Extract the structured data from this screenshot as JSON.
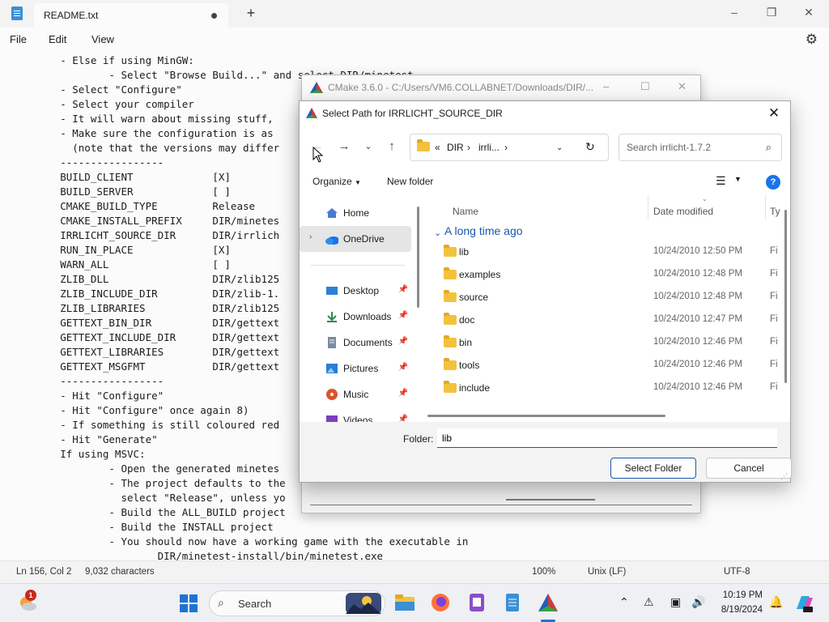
{
  "notepad": {
    "tab_title": "README.txt",
    "new_tab": "+",
    "menu": [
      "File",
      "Edit",
      "View"
    ],
    "lines_left": [
      "        - Else if using MinGW:",
      "                - Select \"Browse Build...\" and select DIR/minetest",
      "        - Select \"Configure\"",
      "        - Select your compiler",
      "        - It will warn about missing stuff,",
      "        - Make sure the configuration is as",
      "          (note that the versions may differ",
      "        -----------------",
      "        BUILD_CLIENT             [X]",
      "        BUILD_SERVER             [ ]",
      "        CMAKE_BUILD_TYPE         Release",
      "        CMAKE_INSTALL_PREFIX     DIR/minetes",
      "        IRRLICHT_SOURCE_DIR      DIR/irrlich",
      "        RUN_IN_PLACE             [X]",
      "        WARN_ALL                 [ ]",
      "        ZLIB_DLL                 DIR/zlib125",
      "        ZLIB_INCLUDE_DIR         DIR/zlib-1.",
      "        ZLIB_LIBRARIES           DIR/zlib125",
      "        GETTEXT_BIN_DIR          DIR/gettext",
      "        GETTEXT_INCLUDE_DIR      DIR/gettext",
      "        GETTEXT_LIBRARIES        DIR/gettext",
      "        GETTEXT_MSGFMT           DIR/gettext",
      "        -----------------",
      "        - Hit \"Configure\"",
      "        - Hit \"Configure\" once again 8)",
      "        - If something is still coloured red",
      "        - Hit \"Generate\"",
      "        If using MSVC:",
      "                - Open the generated minetes",
      "                - The project defaults to the",
      "                  select \"Release\", unless yo",
      "                - Build the ALL_BUILD project",
      "                - Build the INSTALL project",
      "                - You should now have a working game with the executable in",
      "                        DIR/minetest-install/bin/minetest.exe"
    ],
    "status": {
      "position": "Ln 156, Col 2",
      "chars": "9,032 characters",
      "zoom": "100%",
      "line_ending": "Unix (LF)",
      "encoding": "UTF-8"
    }
  },
  "cmake": {
    "title": "CMake 3.6.0 - C:/Users/VM6.COLLABNET/Downloads/DIR/..."
  },
  "dialog": {
    "title": "Select Path for IRRLICHT_SOURCE_DIR",
    "breadcrumb": [
      "«",
      "DIR",
      "›",
      "irrli...",
      "›"
    ],
    "search_placeholder": "Search irrlicht-1.7.2",
    "organize": "Organize",
    "new_folder": "New folder",
    "help": "?",
    "nav": [
      {
        "label": "Home",
        "icon": "home-icon"
      },
      {
        "label": "OneDrive",
        "icon": "onedrive-icon"
      },
      {
        "label": "Desktop",
        "icon": "desktop-icon"
      },
      {
        "label": "Downloads",
        "icon": "downloads-icon"
      },
      {
        "label": "Documents",
        "icon": "documents-icon"
      },
      {
        "label": "Pictures",
        "icon": "pictures-icon"
      },
      {
        "label": "Music",
        "icon": "music-icon"
      },
      {
        "label": "Videos",
        "icon": "videos-icon"
      }
    ],
    "columns": {
      "name": "Name",
      "date": "Date modified",
      "type": "Ty"
    },
    "group": "A long time ago",
    "files": [
      {
        "name": "lib",
        "date": "10/24/2010 12:50 PM",
        "type": "Fi"
      },
      {
        "name": "examples",
        "date": "10/24/2010 12:48 PM",
        "type": "Fi"
      },
      {
        "name": "source",
        "date": "10/24/2010 12:48 PM",
        "type": "Fi"
      },
      {
        "name": "doc",
        "date": "10/24/2010 12:47 PM",
        "type": "Fi"
      },
      {
        "name": "bin",
        "date": "10/24/2010 12:46 PM",
        "type": "Fi"
      },
      {
        "name": "tools",
        "date": "10/24/2010 12:46 PM",
        "type": "Fi"
      },
      {
        "name": "include",
        "date": "10/24/2010 12:46 PM",
        "type": "Fi"
      }
    ],
    "folder_label": "Folder:",
    "folder_value": "lib",
    "select_button": "Select Folder",
    "cancel_button": "Cancel"
  },
  "taskbar": {
    "weather_badge": "1",
    "search_label": "Search",
    "time": "10:19 PM",
    "date": "8/19/2024"
  },
  "colors": {
    "accent": "#1a58a8",
    "folder": "#f3c23d",
    "taskbar_blue": "#1f74d2"
  }
}
